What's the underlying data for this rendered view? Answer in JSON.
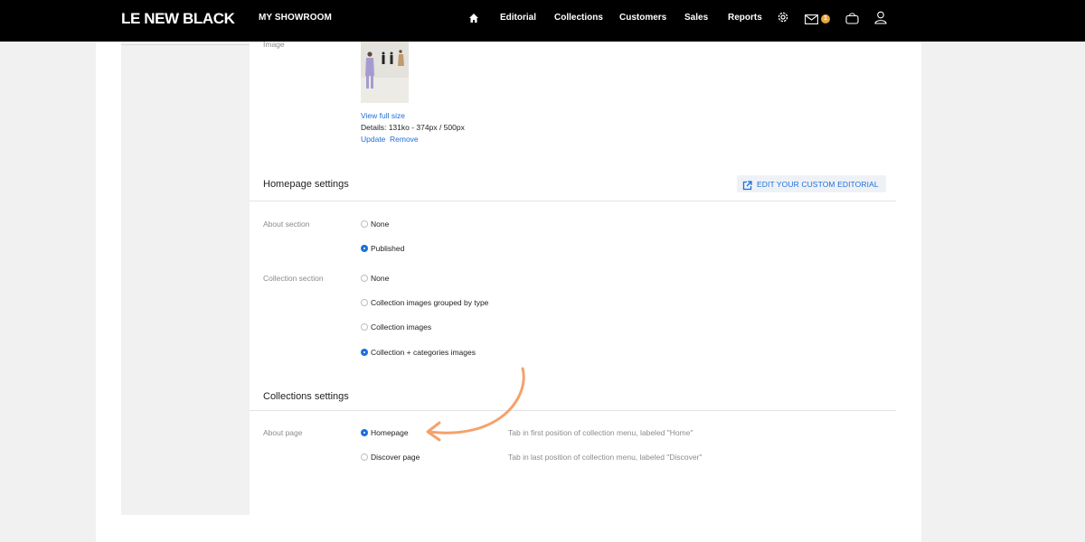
{
  "header": {
    "logo": "LE NEW BLACK",
    "showroom": "MY SHOWROOM",
    "nav": [
      "Editorial",
      "Collections",
      "Customers",
      "Sales",
      "Reports"
    ],
    "notification_count": "1"
  },
  "image_section": {
    "label": "Image",
    "view_full_size": "View full size",
    "details": "Details: 131ko - 374px / 500px",
    "update": "Update",
    "remove": "Remove"
  },
  "homepage_settings": {
    "title": "Homepage settings",
    "edit_button": "EDIT YOUR CUSTOM EDITORIAL",
    "about_section": {
      "label": "About section",
      "options": [
        "None",
        "Published"
      ],
      "selected": "Published"
    },
    "collection_section": {
      "label": "Collection section",
      "options": [
        "None",
        "Collection images grouped by type",
        "Collection images",
        "Collection + categories images"
      ],
      "selected": "Collection + categories images"
    }
  },
  "collections_settings": {
    "title": "Collections settings",
    "about_page": {
      "label": "About page",
      "options": [
        {
          "label": "Homepage",
          "hint": "Tab in first position of collection menu, labeled \"Home\""
        },
        {
          "label": "Discover page",
          "hint": "Tab in last position of collection menu, labeled \"Discover\""
        }
      ],
      "selected": "Homepage"
    }
  },
  "colors": {
    "accent": "#1e6fd9",
    "annotation_arrow": "#f4a26b",
    "header_bg": "#000000"
  }
}
